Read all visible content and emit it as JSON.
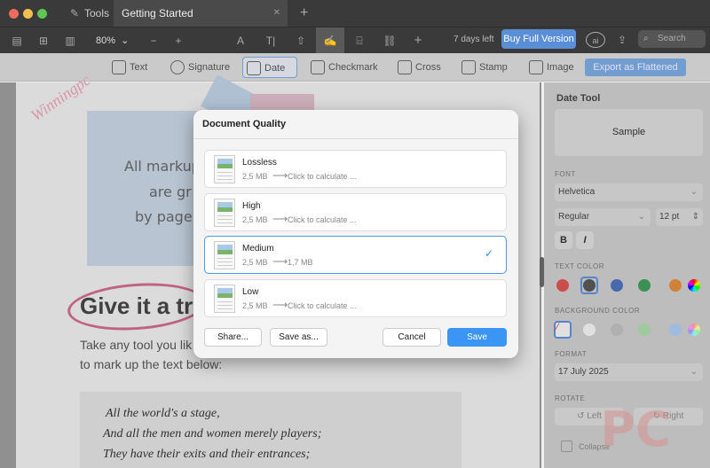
{
  "titlebar": {
    "tabs": [
      {
        "label": "Tools"
      },
      {
        "label": "Getting Started"
      }
    ],
    "new_tab": "+",
    "close_tab": "✕"
  },
  "toolbar": {
    "zoom": "80%",
    "zoom_out": "−",
    "zoom_in": "+",
    "add": "+",
    "trial_text": "7 days left",
    "buy_label": "Buy Full Version",
    "ai_label": "ai",
    "search_placeholder": "Search"
  },
  "tools": {
    "items": [
      {
        "label": "Text"
      },
      {
        "label": "Signature"
      },
      {
        "label": "Date"
      },
      {
        "label": "Checkmark"
      },
      {
        "label": "Cross"
      },
      {
        "label": "Stamp"
      },
      {
        "label": "Image"
      }
    ],
    "selected": "Date",
    "export_label": "Export as Flattened"
  },
  "document": {
    "watermark": "Winningpc",
    "sticky_lines": [
      "All markup",
      "are gr",
      "by page"
    ],
    "headline": "Give it a try",
    "body_lines": [
      "Take any tool you lik",
      "to mark up the text below:"
    ],
    "quote_lines": [
      "All the world's a stage,",
      "And all the men and women merely players;",
      "They have their exits and their entrances;"
    ]
  },
  "sidebar": {
    "title": "Date Tool",
    "sample": "Sample",
    "font_label": "FONT",
    "font_family": "Helvetica",
    "font_style": "Regular",
    "font_size": "12 pt",
    "bold": "B",
    "italic": "I",
    "text_color_label": "TEXT COLOR",
    "text_colors": [
      "#d9534f",
      "#555555",
      "#4f6fb8",
      "#3f9a5a",
      "#e08a3c"
    ],
    "bg_color_label": "BACKGROUND COLOR",
    "bg_colors": [
      "#eeeeee",
      "#bbbbbb",
      "#a8d8a8",
      "#a9c7ef"
    ],
    "format_label": "FORMAT",
    "date_format": "17 July 2025",
    "rotate_label": "ROTATE",
    "rotate_left": "Left",
    "rotate_right": "Right",
    "collapse": "Collapse",
    "logo_text": "PC"
  },
  "dialog": {
    "title": "Document Quality",
    "options": [
      {
        "name": "Lossless",
        "size": "2,5 MB",
        "result": "Click to calculate ...",
        "selected": false
      },
      {
        "name": "High",
        "size": "2,5 MB",
        "result": "Click to calculate ...",
        "selected": false
      },
      {
        "name": "Medium",
        "size": "2,5 MB",
        "result": "1,7 MB",
        "selected": true
      },
      {
        "name": "Low",
        "size": "2,5 MB",
        "result": "Click to calculate ...",
        "selected": false
      }
    ],
    "share_label": "Share...",
    "save_as_label": "Save as...",
    "cancel_label": "Cancel",
    "save_label": "Save"
  }
}
